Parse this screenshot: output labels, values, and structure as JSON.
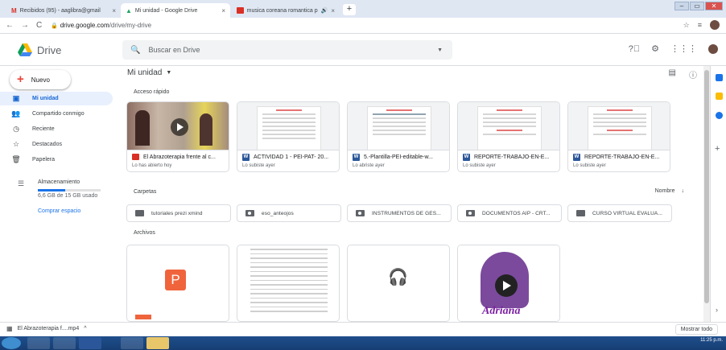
{
  "tabs": [
    {
      "label": "Recibidos (95) - aaglibra@gmail",
      "icon": "gmail-icon",
      "close": "×"
    },
    {
      "label": "Mi unidad - Google Drive",
      "icon": "drive-icon",
      "close": "×"
    },
    {
      "label": "musica coreana romantica p",
      "icon": "youtube-icon",
      "close": "×"
    }
  ],
  "newtab_label": "+",
  "address": {
    "host": "drive.google.com",
    "path": "/drive/my-drive",
    "lock": "🔒"
  },
  "app": {
    "brand": "Drive",
    "search_placeholder": "Buscar en Drive"
  },
  "sidebar": {
    "new_label": "Nuevo",
    "items": [
      {
        "label": "Mi unidad",
        "icon": "my-drive-icon",
        "glyph": "▣"
      },
      {
        "label": "Compartido conmigo",
        "icon": "shared-icon",
        "glyph": "👥"
      },
      {
        "label": "Reciente",
        "icon": "clock-icon",
        "glyph": "◷"
      },
      {
        "label": "Destacados",
        "icon": "star-icon",
        "glyph": "☆"
      },
      {
        "label": "Papelera",
        "icon": "trash-icon",
        "glyph": "🗑"
      }
    ],
    "storage_title": "Almacenamiento",
    "storage_used": "6,6 GB de 15 GB usado",
    "storage_fraction": 0.44,
    "buy_label": "Comprar espacio"
  },
  "main": {
    "breadcrumb": "Mi unidad",
    "quick_access_title": "Acceso rápido",
    "quick_access": [
      {
        "name": "El Abrazoterapia frente al c...",
        "sub": "Lo has abierto hoy",
        "type": "video"
      },
      {
        "name": "ACTIVIDAD 1 - PEI-PAT- 20...",
        "sub": "Lo subiste ayer",
        "type": "word"
      },
      {
        "name": "5.-Plantilla-PEI-editable-w...",
        "sub": "Lo abriste ayer",
        "type": "word"
      },
      {
        "name": "REPORTE-TRABAJO-EN-E...",
        "sub": "Lo subiste ayer",
        "type": "word"
      },
      {
        "name": "REPORTE-TRABAJO-EN-E...",
        "sub": "Lo subiste ayer",
        "type": "word"
      }
    ],
    "folders_title": "Carpetas",
    "sort_label": "Nombre",
    "sort_arrow": "↓",
    "folders": [
      {
        "name": "tutoriales prezi xmind",
        "shared": false
      },
      {
        "name": "eso_anteojos",
        "shared": true
      },
      {
        "name": "INSTRUMENTOS DE GES...",
        "shared": true
      },
      {
        "name": "DOCUMENTOS AIP - CRT...",
        "shared": true
      },
      {
        "name": "CURSO VIRTUAL EVALUA...",
        "shared": false
      }
    ],
    "files_title": "Archivos",
    "file_thumb_ppt": "P",
    "file_thumb_image": "Adriana"
  },
  "download": {
    "file": "El Abrazoterapia f....mp4",
    "caret": "^",
    "show_all": "Mostrar todo"
  },
  "clock": {
    "time": "11:25 p.m."
  },
  "colors": {
    "accent": "#1a73e8",
    "selected_bg": "#e8f0fe",
    "ppt": "#f0643c",
    "word": "#2b579a"
  }
}
